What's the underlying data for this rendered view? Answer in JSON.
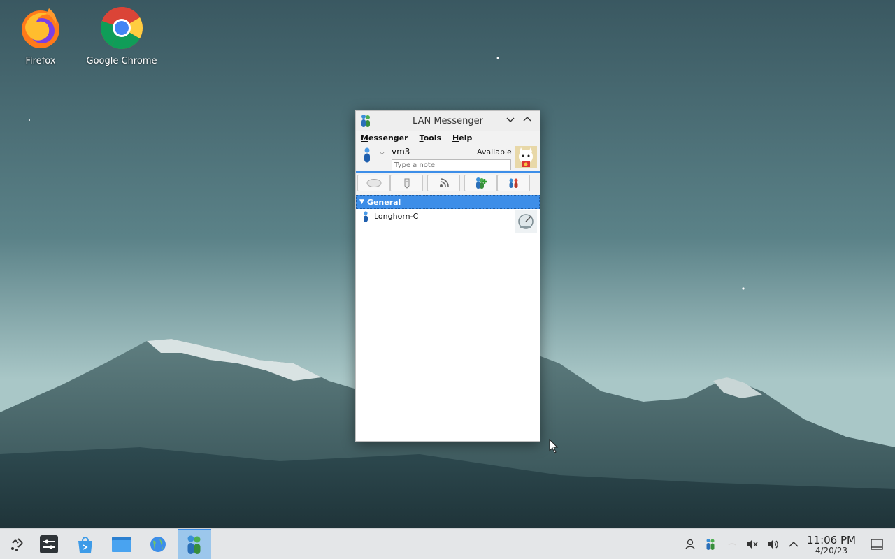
{
  "desktop": {
    "icons": [
      {
        "label": "Firefox",
        "icon": "firefox-icon"
      },
      {
        "label": "Google Chrome",
        "icon": "chrome-icon"
      }
    ]
  },
  "window": {
    "title": "LAN Messenger",
    "menu": [
      "Messenger",
      "Tools",
      "Help"
    ],
    "user": {
      "name": "vm3",
      "status": "Available",
      "note_placeholder": "Type a note"
    },
    "toolbar": [
      {
        "icon": "chat-icon"
      },
      {
        "icon": "file-transfer-icon"
      },
      {
        "icon": "broadcast-icon"
      },
      {
        "icon": "add-contact-icon"
      },
      {
        "icon": "group-icon"
      }
    ],
    "groups": [
      {
        "name": "General",
        "contacts": [
          {
            "name": "Longhorn-C"
          }
        ]
      }
    ]
  },
  "taskbar": {
    "items": [
      "app-launcher-icon",
      "settings-icon",
      "discover-icon",
      "file-manager-icon",
      "globe-icon",
      "lan-messenger-icon"
    ],
    "tray": [
      "user-icon",
      "lan-messenger-tray-icon",
      "network-icon",
      "muted-speaker-icon",
      "volume-icon",
      "expand-tray-icon"
    ],
    "time": "11:06 PM",
    "date": "4/20/23"
  },
  "colors": {
    "accent": "#3d8ee8",
    "taskbar": "#e4e6e8"
  }
}
